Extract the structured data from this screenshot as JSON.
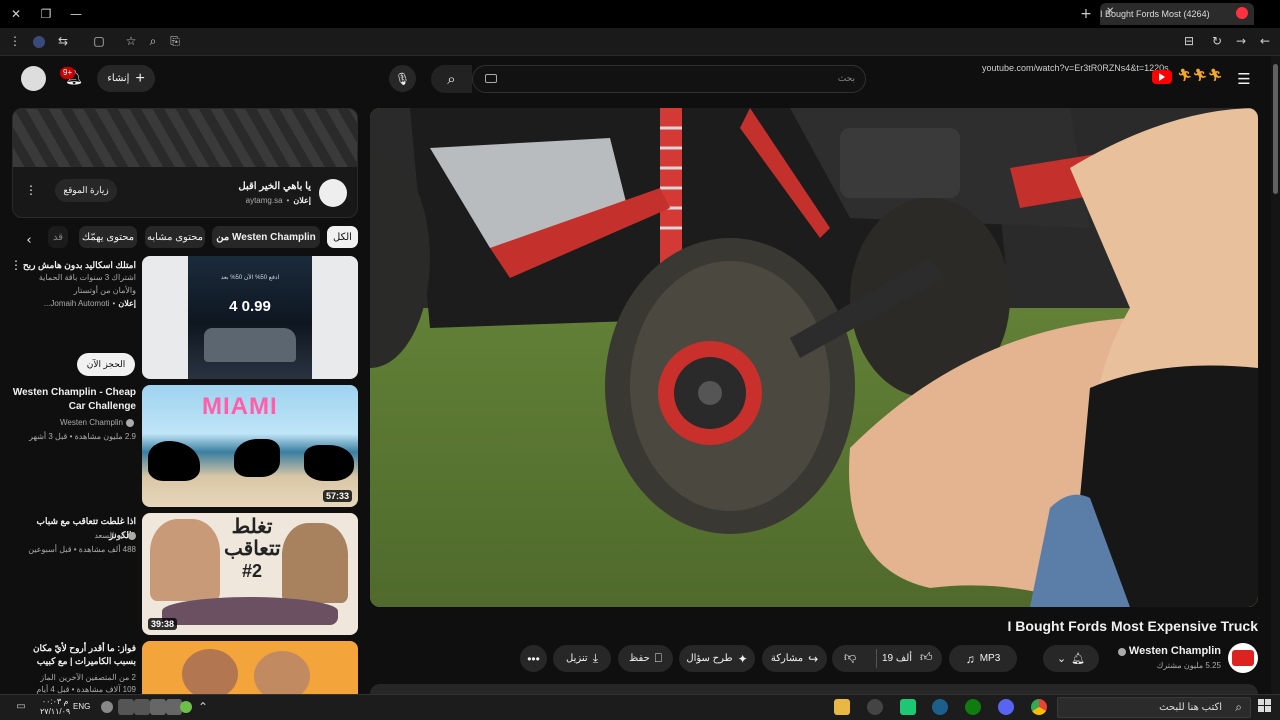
{
  "browser": {
    "tab_title": "(4264) I Bought Fords Most",
    "url": "youtube.com/watch?v=Er3tR0RZNs4&t=1220s"
  },
  "header": {
    "create_label": "إنشاء",
    "notification_badge": "9+",
    "search_placeholder": "بحث"
  },
  "ad_card": {
    "title": "يا باهي الخير اقبل",
    "sponsored": "إعلان",
    "domain": "aytamg.sa",
    "visit_button": "زيارة الموقع"
  },
  "filter_chips": [
    "الكل",
    "من Westen Champlin",
    "محتوى مشابه",
    "محتوى يهمّك",
    "قد"
  ],
  "sidebar_videos": [
    {
      "title": "امتلك اسكاليد بدون هامش ربح",
      "desc_line1": "اشتراك 3 سنوات باقة الحماية",
      "desc_line2": "والأمان من أوتستار",
      "sponsor": "إعلان",
      "channel": "Jomaih Automoti...",
      "cta": "الحجز الآن",
      "thumb_price": "4 0.99",
      "thumb_offer": "ادفع 50% الآن 50% بعد"
    },
    {
      "title": "Westen Champlin - Cheap Car Challenge",
      "channel": "Westen Champlin",
      "meta": "2.9 مليون مشاهدة • قبل 3 أشهر",
      "duration": "57:33",
      "thumb_text": "MIAMI"
    },
    {
      "title": "اذا غلطت تتعاقب مع شباب فالكونز",
      "channel": "ابو السعد",
      "meta": "488 ألف مشاهدة • قبل أسبوعين",
      "duration": "39:38",
      "thumb_line1": "تغلط",
      "thumb_line2": "تتعاقب",
      "thumb_line3": "#2"
    },
    {
      "title": "فواز: ما أقدر أروح لأيّ مكان بسبب الكاميرات | مع كبيب",
      "channel": "الماز",
      "meta": "109 آلاف مشاهدة • قبل 4 أيام",
      "members": "2 من المتصفين الآخرين"
    }
  ],
  "video": {
    "title": "I Bought Fords Most Expensive Truck",
    "channel": "Westen Champlin",
    "subscribers": "5.25 مليون مشترك",
    "likes": "19 ألف",
    "mp3": "MP3",
    "share": "مشاركة",
    "ask": "طرح سؤال",
    "save": "حفظ",
    "download": "تنزيل"
  },
  "taskbar": {
    "search_placeholder": "اكتب هنا للبحث",
    "lang": "ENG",
    "time": "۰۰:۰۳ م",
    "date": "۲۷/۱۱/۰۹"
  },
  "colors": {
    "yt_red": "#ff0000",
    "bg": "#0f0f0f",
    "chip": "#272727"
  }
}
